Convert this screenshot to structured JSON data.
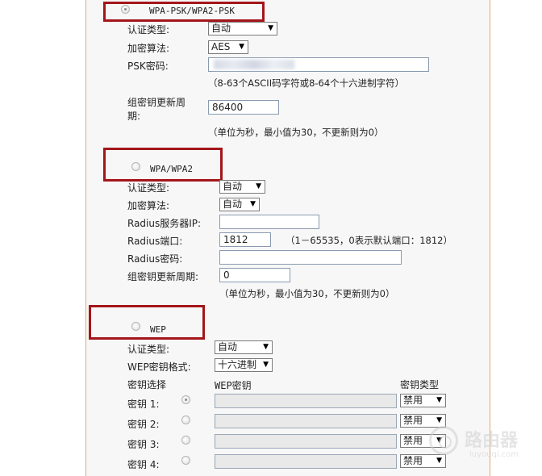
{
  "wpa_psk": {
    "title": "WPA-PSK/WPA2-PSK",
    "auth_label": "认证类型:",
    "auth_value": "自动",
    "enc_label": "加密算法:",
    "enc_value": "AES",
    "psk_label": "PSK密码:",
    "psk_hint": "（8-63个ASCII码字符或8-64个十六进制字符）",
    "group_label_1": "组密钥更新周",
    "group_label_2": "期:",
    "group_value": "86400",
    "group_hint": "（单位为秒，最小值为30，不更新则为0）"
  },
  "wpa": {
    "title": "WPA/WPA2",
    "auth_label": "认证类型:",
    "auth_value": "自动",
    "enc_label": "加密算法:",
    "enc_value": "自动",
    "radius_ip_label": "Radius服务器IP:",
    "radius_ip_value": "",
    "radius_port_label": "Radius端口:",
    "radius_port_value": "1812",
    "radius_port_hint": "（1－65535，0表示默认端口：1812）",
    "radius_pwd_label": "Radius密码:",
    "radius_pwd_value": "",
    "group_label": "组密钥更新周期:",
    "group_value": "0",
    "group_hint": "（单位为秒，最小值为30，不更新则为0）"
  },
  "wep": {
    "title": "WEP",
    "auth_label": "认证类型:",
    "auth_value": "自动",
    "format_label": "WEP密钥格式:",
    "format_value": "十六进制",
    "col_key_select": "密钥选择",
    "col_wep_key": "WEP密钥",
    "col_key_type": "密钥类型",
    "keys": [
      {
        "label": "密钥 1:",
        "type": "禁用"
      },
      {
        "label": "密钥 2:",
        "type": "禁用"
      },
      {
        "label": "密钥 3:",
        "type": "禁用"
      },
      {
        "label": "密钥 4:",
        "type": "禁用"
      }
    ]
  },
  "watermark": {
    "brand": "路由器",
    "domain": "luyouqi.com"
  },
  "colors": {
    "highlight_box": "#a3161a",
    "panel_border": "#e2a87a"
  }
}
